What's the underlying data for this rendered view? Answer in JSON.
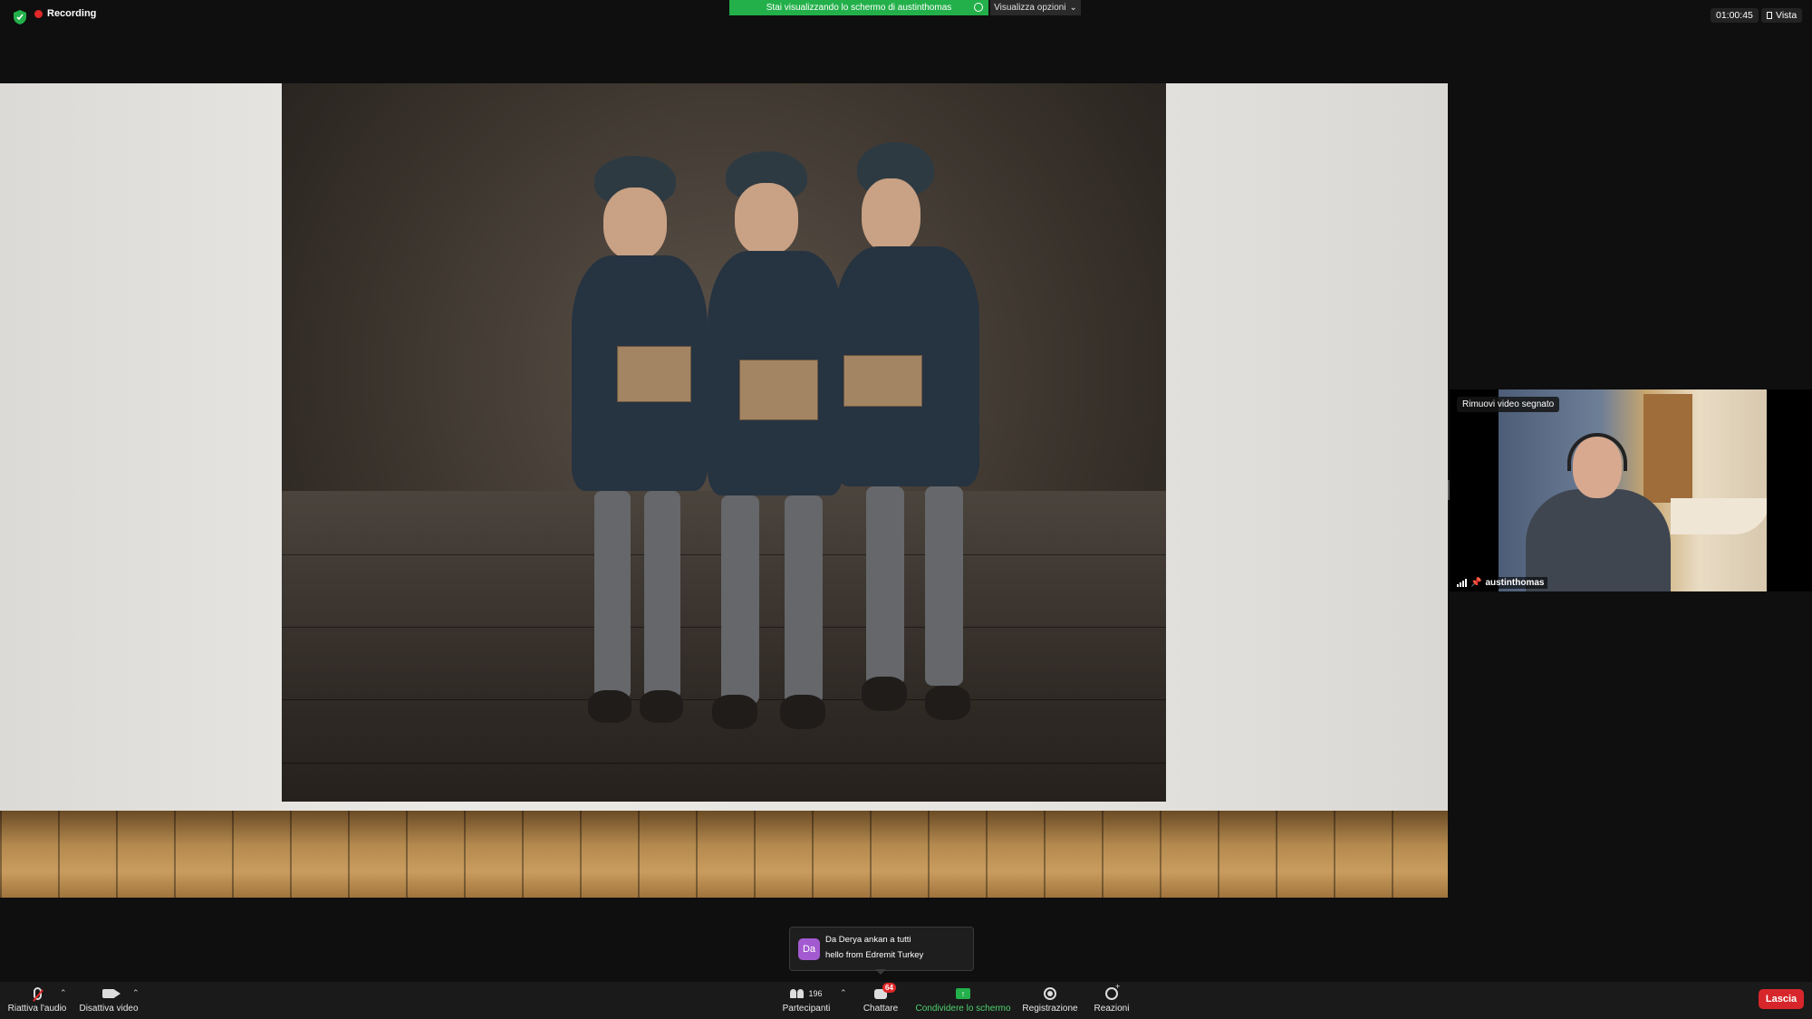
{
  "topbar": {
    "recording_label": "Recording",
    "share_banner": "Stai visualizzando lo schermo di austinthomas",
    "view_options": "Visualizza opzioni",
    "timer": "01:00:45",
    "view_label": "Vista"
  },
  "video": {
    "pin_tag": "Rimuovi video segnato",
    "participant_name": "austinthomas"
  },
  "chat_toast": {
    "avatar_initials": "Da",
    "line1": "Da Derya  ankan a tutti",
    "line2": "hello from Edremit Turkey"
  },
  "toolbar": {
    "audio": "Riattiva l'audio",
    "video": "Disattiva video",
    "participants": "Partecipanti",
    "participants_count": "196",
    "chat": "Chattare",
    "chat_badge": "64",
    "share": "Condividere lo schermo",
    "record": "Registrazione",
    "reactions": "Reazioni",
    "leave": "Lascia"
  },
  "colors": {
    "share_green": "#23b04a",
    "recording_red": "#e02828",
    "leave_red": "#d7262b"
  }
}
